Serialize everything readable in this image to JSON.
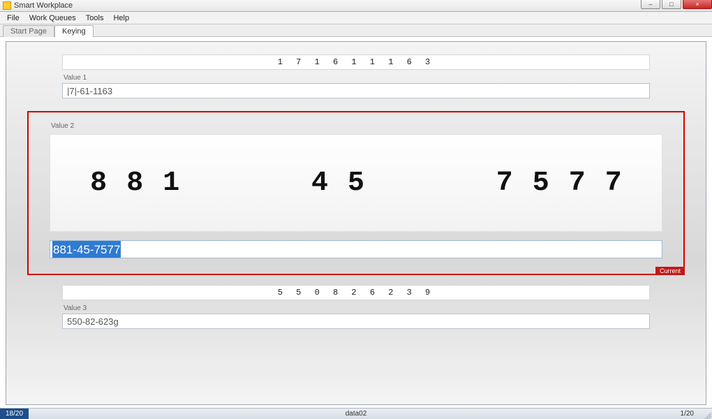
{
  "window": {
    "title": "Smart Workplace",
    "min": "–",
    "max": "□",
    "close": "×"
  },
  "menu": {
    "file": "File",
    "work_queues": "Work Queues",
    "tools": "Tools",
    "help": "Help"
  },
  "tabs": {
    "start": "Start Page",
    "keying": "Keying"
  },
  "value1": {
    "label": "Value 1",
    "snippet": "1 7 1   6 1   1 1 6 3",
    "input": "|7|-61-1163"
  },
  "value2": {
    "label": "Value 2",
    "big_g1_a": "8",
    "big_g1_b": "8",
    "big_g1_c": "1",
    "big_g2_a": "4",
    "big_g2_b": "5",
    "big_g3_a": "7",
    "big_g3_b": "5",
    "big_g3_c": "7",
    "big_g3_d": "7",
    "input_selected": "881-45-7577",
    "current_tag": "Current"
  },
  "value3": {
    "label": "Value 3",
    "snippet": "5 5 0   8 2   6 2 3 9",
    "input": "550-82-623g"
  },
  "status": {
    "left": "18/20",
    "center": "data02",
    "right": "1/20"
  }
}
